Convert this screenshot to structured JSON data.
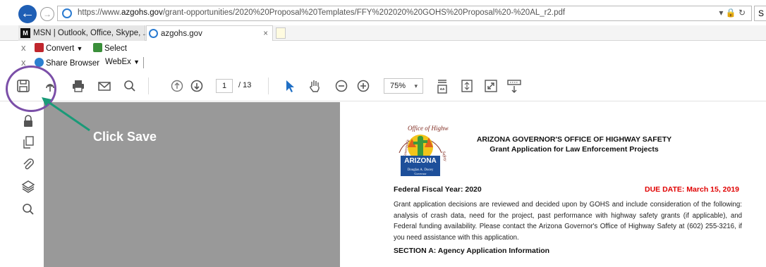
{
  "browser": {
    "url_prefix": "https://www.",
    "url_domain": "azgohs.gov",
    "url_path": "/grant-opportunities/2020%20Proposal%20Templates/FFY%202020%20GOHS%20Proposal%20-%20AL_r2.pdf",
    "url_tools": "▾ 🔒 ↻",
    "url_extra": "S",
    "back_symbol": "←",
    "forward_symbol": "→",
    "tabs": [
      {
        "label": "MSN | Outlook, Office, Skype, ...",
        "icon": "msn-icon"
      },
      {
        "label": "azgohs.gov",
        "icon": "ie-icon",
        "close": "×"
      }
    ],
    "command_bar": {
      "close_symbol": "x",
      "convert_label": "Convert",
      "convert_arrow": "▼",
      "select_label": "Select",
      "share_label": "Share Browser",
      "webex_label": "WebEx",
      "webex_arrow": "▼"
    }
  },
  "pdf_toolbar": {
    "current_page": "1",
    "total_pages": "/ 13",
    "zoom": "75%",
    "zoom_arrow": "▾",
    "icons": [
      "save-icon",
      "upload-icon",
      "print-icon",
      "email-icon",
      "search-icon",
      "prev-page-icon",
      "next-page-icon",
      "select-cursor-icon",
      "hand-tool-icon",
      "zoom-out-icon",
      "zoom-in-icon",
      "fit-width-icon",
      "fit-page-icon",
      "full-screen-icon",
      "read-mode-icon"
    ]
  },
  "left_rail": {
    "icons": [
      "lock-icon",
      "pages-icon",
      "attachment-icon",
      "layers-icon",
      "search-icon"
    ]
  },
  "annotation": {
    "label": "Click Save",
    "ring_color": "#7b4fa8",
    "arrow_color": "#1a9a78"
  },
  "document": {
    "seal_text_top": "Office of Highway",
    "seal_text_side_left": "Governor's",
    "seal_text_side_right": "Safety",
    "seal_state": "ARIZONA",
    "seal_name": "Douglas A. Ducey",
    "seal_role": "Governor",
    "title_line1": "ARIZONA GOVERNOR'S OFFICE OF HIGHWAY SAFETY",
    "title_line2": "Grant Application for Law Enforcement Projects",
    "fiscal_year": "Federal Fiscal Year: 2020",
    "due_date": "DUE DATE: March 15, 2019",
    "due_color": "#e00000",
    "paragraph": "Grant application decisions are reviewed and decided upon by GOHS and include consideration of the following: analysis of crash data, need for the project, past performance with highway safety grants (if applicable), and Federal funding availability. Please contact the Arizona Governor's Office of Highway Safety at (602) 255-3216, if you need assistance with this application.",
    "section_heading": "SECTION A: Agency Application Information"
  }
}
